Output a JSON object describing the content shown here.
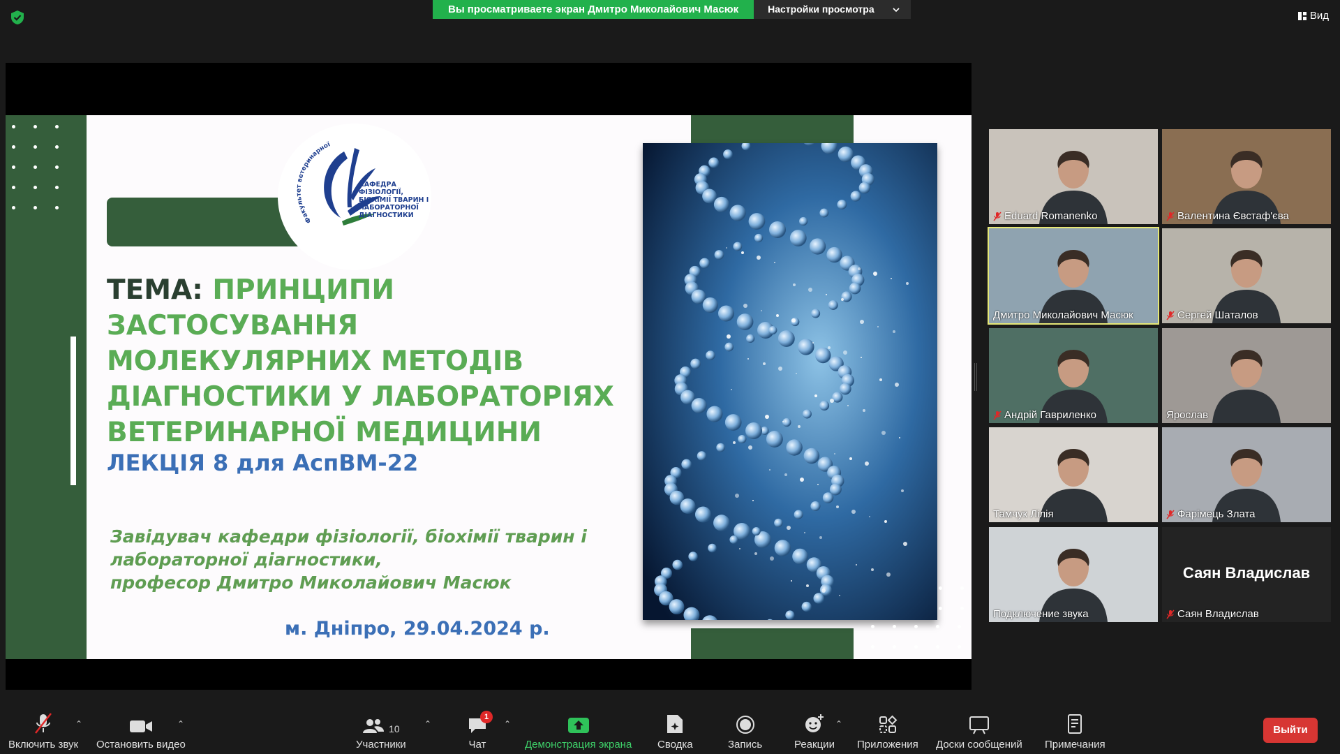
{
  "banner": {
    "sharing_text": "Вы просматриваете экран Дмитро Миколайович Масюк",
    "view_settings": "Настройки просмотра"
  },
  "view_button": "Вид",
  "slide": {
    "tema_label": "ТЕМА:",
    "title_lines": [
      "ПРИНЦИПИ ЗАСТОСУВАННЯ",
      "МОЛЕКУЛЯРНИХ МЕТОДІВ",
      "ДІАГНОСТИКИ У ЛАБОРАТОРІЯХ",
      "ВЕТЕРИНАРНОЇ МЕДИЦИНИ"
    ],
    "lecture": "ЛЕКЦІЯ 8 для АспВМ-22",
    "author_lines": [
      "Завідувач кафедри фізіології, біохімії тварин і",
      "лабораторної діагностики,",
      "професор Дмитро Миколайович Масюк"
    ],
    "date": "м. Дніпро, 29.04.2024 р.",
    "logo_lines": [
      "КАФЕДРА",
      "ФІЗІОЛОГІЇ,",
      "БІОХІМІЇ ТВАРИН І",
      "ЛАБОРАТОРНОЇ",
      "ДІАГНОСТИКИ"
    ],
    "logo_arc": "Факультет ветеринарної медицини"
  },
  "participants": [
    {
      "name": "Eduard Romanenko",
      "muted": true,
      "bg": "#c9c3bb"
    },
    {
      "name": "Валентина Євстаф'єва",
      "muted": true,
      "bg": "#8a6e52"
    },
    {
      "name": "Дмитро Миколайович Масюк",
      "muted": false,
      "bg": "#8fa3b0"
    },
    {
      "name": "Сергей Шаталов",
      "muted": true,
      "bg": "#b7b3aa"
    },
    {
      "name": "Андрій Гавриленко",
      "muted": true,
      "bg": "#4f6f64"
    },
    {
      "name": "Ярослав",
      "muted": false,
      "bg": "#9e9995"
    },
    {
      "name": "Тамчук Лілія",
      "muted": false,
      "bg": "#d8d4cf"
    },
    {
      "name": "Фарімець Злата",
      "muted": true,
      "bg": "#a8acb2"
    },
    {
      "name": "Подключение звука",
      "muted": false,
      "bg": "#cfd3d6"
    },
    {
      "name": "Саян Владислав",
      "muted": true,
      "bg": "#232323",
      "bigname": "Саян Владислав"
    }
  ],
  "toolbar": {
    "unmute": "Включить звук",
    "stop_video": "Остановить видео",
    "participants": "Участники",
    "participants_count": "10",
    "chat": "Чат",
    "chat_badge": "1",
    "share_screen": "Демонстрация экрана",
    "summary": "Сводка",
    "record": "Запись",
    "reactions": "Реакции",
    "apps": "Приложения",
    "whiteboards": "Доски сообщений",
    "notes": "Примечания",
    "leave": "Выйти"
  },
  "colors": {
    "accent_green": "#22b14c",
    "slide_dark_green": "#355e3b",
    "title_green": "#5aac55",
    "blue_text": "#3b6fb6",
    "leave_red": "#d73633",
    "speaker_highlight": "#e6e877"
  }
}
